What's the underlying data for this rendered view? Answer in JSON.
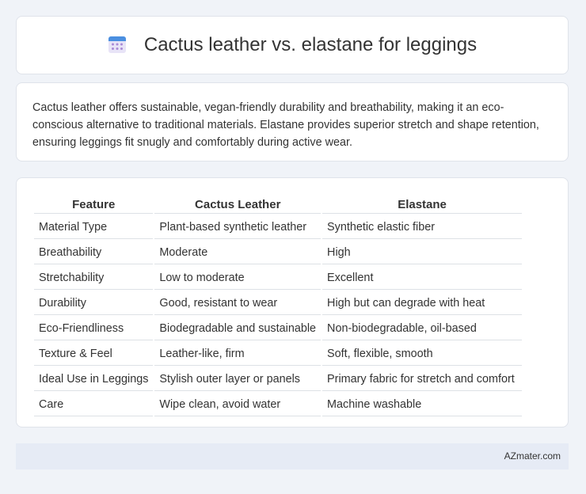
{
  "header": {
    "icon": "calendar-icon",
    "title": "Cactus leather vs. elastane for leggings"
  },
  "summary": {
    "text": "Cactus leather offers sustainable, vegan-friendly durability and breathability, making it an eco-conscious alternative to traditional materials. Elastane provides superior stretch and shape retention, ensuring leggings fit snugly and comfortably during active wear."
  },
  "table": {
    "headers": [
      "Feature",
      "Cactus Leather",
      "Elastane"
    ],
    "rows": [
      [
        "Material Type",
        "Plant-based synthetic leather",
        "Synthetic elastic fiber"
      ],
      [
        "Breathability",
        "Moderate",
        "High"
      ],
      [
        "Stretchability",
        "Low to moderate",
        "Excellent"
      ],
      [
        "Durability",
        "Good, resistant to wear",
        "High but can degrade with heat"
      ],
      [
        "Eco-Friendliness",
        "Biodegradable and sustainable",
        "Non-biodegradable, oil-based"
      ],
      [
        "Texture & Feel",
        "Leather-like, firm",
        "Soft, flexible, smooth"
      ],
      [
        "Ideal Use in Leggings",
        "Stylish outer layer or panels",
        "Primary fabric for stretch and comfort"
      ],
      [
        "Care",
        "Wipe clean, avoid water",
        "Machine washable"
      ]
    ]
  },
  "footer": {
    "brand": "AZmater.com"
  }
}
